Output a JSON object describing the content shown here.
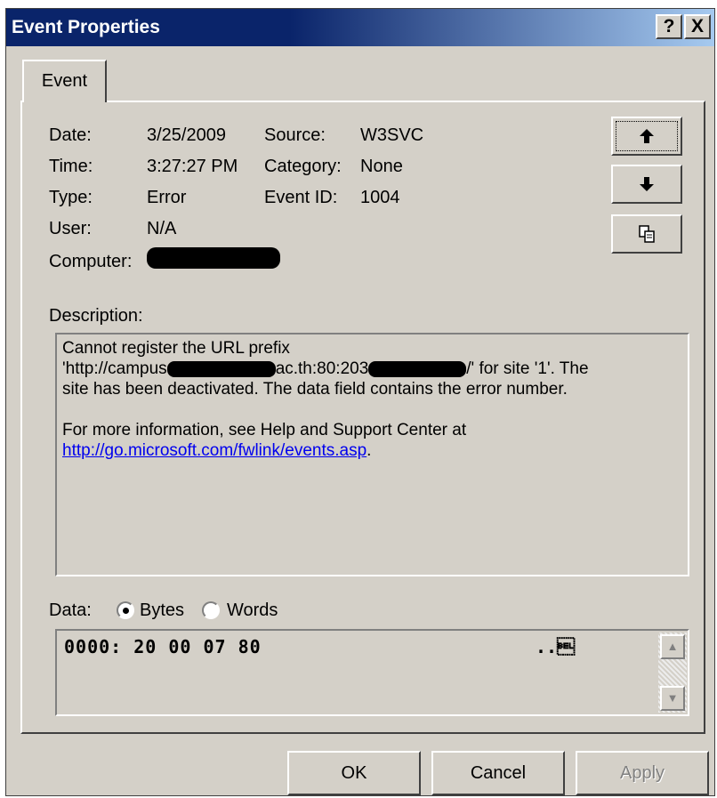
{
  "window": {
    "title": "Event Properties",
    "help_glyph": "?",
    "close_glyph": "X"
  },
  "tabs": [
    {
      "label": "Event"
    }
  ],
  "fields": {
    "date_label": "Date:",
    "date_value": "3/25/2009",
    "time_label": "Time:",
    "time_value": "3:27:27 PM",
    "type_label": "Type:",
    "type_value": "Error",
    "user_label": "User:",
    "user_value": "N/A",
    "computer_label": "Computer:",
    "computer_value": "[redacted]",
    "source_label": "Source:",
    "source_value": "W3SVC",
    "category_label": "Category:",
    "category_value": "None",
    "event_id_label": "Event ID:",
    "event_id_value": "1004"
  },
  "icons": {
    "up": "arrow-up-icon",
    "down": "arrow-down-icon",
    "copy": "copy-icon"
  },
  "description": {
    "label": "Description:",
    "line1": "Cannot register the URL prefix",
    "line2_a": "'http://campus",
    "line2_b": "ac.th:80:203",
    "line2_c": "/' for site '1'. The",
    "line3": "site has been deactivated.  The data field contains the error number.",
    "line4": "For more information, see Help and Support Center at",
    "link": "http://go.microsoft.com/fwlink/events.asp",
    "link_tail": "."
  },
  "data": {
    "label": "Data:",
    "bytes_label": "Bytes",
    "words_label": "Words",
    "selected": "Bytes",
    "line": "0000: 20 00 07 80",
    "ascii": "..\u0007"
  },
  "buttons": {
    "ok": "OK",
    "cancel": "Cancel",
    "apply": "Apply"
  }
}
